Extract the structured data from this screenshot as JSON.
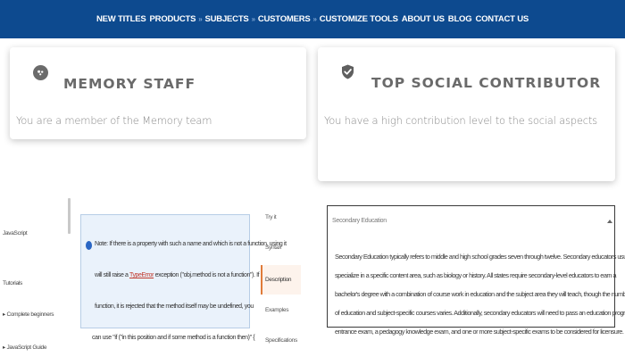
{
  "nav": {
    "new_titles": "NEW TITLES",
    "products": "PRODUCTS",
    "subjects": "SUBJECTS",
    "customers": "CUSTOMERS",
    "customize_tools": "CUSTOMIZE TOOLS",
    "about_us": "ABOUT US",
    "blog": "BLOG",
    "contact_us": "CONTACT US",
    "separator": "»"
  },
  "cards": {
    "memory": {
      "title": "MEMORY STAFF",
      "description": "You are a member of the Memory team",
      "icon": "memory-brain-icon"
    },
    "social": {
      "title": "TOP SOCIAL CONTRIBUTOR",
      "description": "You have a high contribution level to the social aspects",
      "icon": "shield-check-icon"
    }
  },
  "docs_sidebar": {
    "items": [
      "JavaScript",
      "Tutorials",
      "Complete beginners",
      "JavaScript Guide"
    ]
  },
  "docs_note": {
    "line1": "Note: If there is a property with such a name and which is not a function, using it",
    "line2_pre": "will still raise a",
    "line2_link": "TypeError",
    "line2_post": "exception (\"obj.method is not a function\"). If it is not a",
    "line3": "function, it is rejected that the method itself may be undefined, you",
    "line4": "can use \"if (\"in this position and if some method is a function then)\" {"
  },
  "right_nav": {
    "items": [
      "Try it",
      "Syntax",
      "Description",
      "Examples",
      "Specifications"
    ],
    "active": "Description"
  },
  "education": {
    "title": "Secondary Education",
    "lines": [
      "Secondary Education typically refers to middle and high school grades seven through twelve. Secondary educators usually",
      "specialize in a specific content area, such as biology or history. All states require secondary-level educators to earn a",
      "bachelor's degree with a combination of course work in education and the subject area they will teach, though the number",
      "of education and subject-specific courses varies. Additionally, secondary educators will need to pass an education program",
      "entrance exam, a pedagogy knowledge exam, and one or more subject-specific exams to be considered for licensure."
    ]
  },
  "colors": {
    "nav_bg": "#0d4a8f",
    "accent_orange": "#e07b39",
    "note_bg": "#eaf2fb"
  }
}
